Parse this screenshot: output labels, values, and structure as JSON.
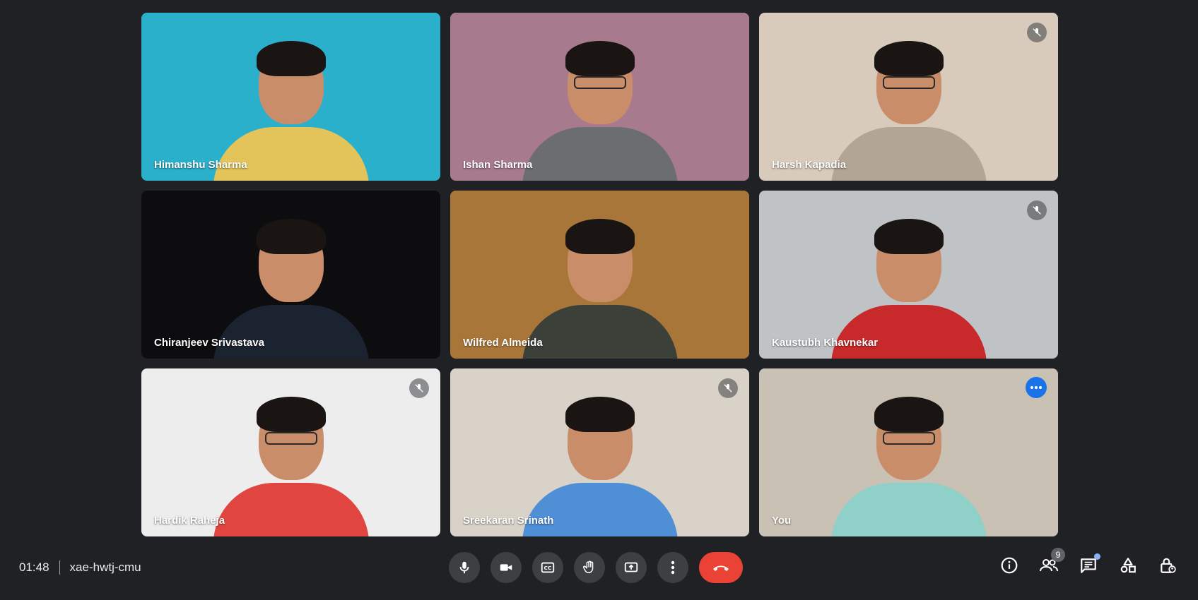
{
  "meeting": {
    "time": "01:48",
    "code": "xae-hwtj-cmu"
  },
  "participants": [
    {
      "name": "Himanshu Sharma",
      "muted": false,
      "bg": "#2bb0cc",
      "shirt": "#e3c45a"
    },
    {
      "name": "Ishan Sharma",
      "muted": false,
      "bg": "#a87a8e",
      "shirt": "#6b6d70"
    },
    {
      "name": "Harsh Kapadia",
      "muted": true,
      "bg": "#d8cbbb",
      "shirt": "#b3a593"
    },
    {
      "name": "Chiranjeev Srivastava",
      "muted": false,
      "bg": "#0d0d0f",
      "shirt": "#1c2330"
    },
    {
      "name": "Wilfred Almeida",
      "muted": false,
      "bg": "#a9763a",
      "shirt": "#3b4038"
    },
    {
      "name": "Kaustubh Khavnekar",
      "muted": true,
      "bg": "#bfc3c5",
      "shirt": "#c8292a"
    },
    {
      "name": "Hardik Raheja",
      "muted": true,
      "bg": "#ededed",
      "shirt": "#e0463f"
    },
    {
      "name": "Sreekaran Srinath",
      "muted": true,
      "bg": "#d9d2c8",
      "shirt": "#4f8fd6"
    },
    {
      "name": "You",
      "muted": false,
      "bg": "#c9c1b3",
      "shirt": "#8fd1c9"
    }
  ],
  "controls": {
    "microphone": "microphone-icon",
    "camera": "camera-icon",
    "captions": "captions-icon",
    "raise_hand": "hand-icon",
    "present": "present-icon",
    "more": "more-options-icon",
    "leave": "end-call-icon"
  },
  "people_count": "9",
  "colors": {
    "background": "#202124",
    "control": "#3c4043",
    "end_call": "#ea4335",
    "active_border": "#8ab4f8",
    "more_badge": "#1a73e8"
  }
}
